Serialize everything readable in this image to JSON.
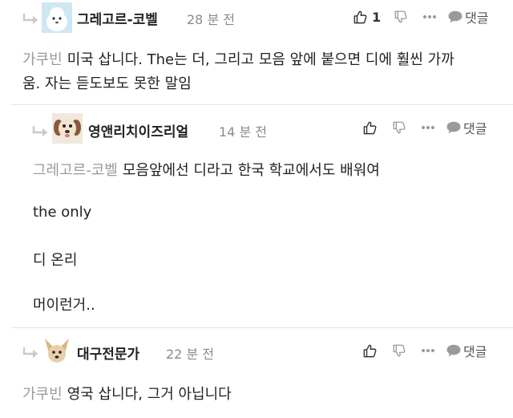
{
  "comments": [
    {
      "nickname": "그레고르-코벨",
      "time": "28 분 전",
      "like_count": "1",
      "reply_label": "댓글",
      "mention": "가쿠빈",
      "lines": [
        "미국 삽니다. The는 더, 그리고 모음 앞에 붙으면 디에 훨씬 가까",
        "움. 자는 듣도보도 못한 말임"
      ]
    },
    {
      "nickname": "영앤리치이즈리얼",
      "time": "14 분 전",
      "like_count": "",
      "reply_label": "댓글",
      "mention": "그레고르-코벨",
      "lines": [
        "모음앞에선 디라고 한국 학교에서도 배워여",
        "the only",
        "디 온리",
        "머이런거.."
      ]
    },
    {
      "nickname": "대구전문가",
      "time": "22 분 전",
      "like_count": "",
      "reply_label": "댓글",
      "mention": "가쿠빈",
      "lines": [
        "영국 삽니다, 그거 아닙니다"
      ]
    }
  ],
  "icons": {
    "reply_arrow": "reply-arrow-icon",
    "like": "thumbs-up-icon",
    "dislike": "thumbs-down-icon",
    "more": "more-dots-icon",
    "reply": "speech-bubble-icon"
  },
  "colors": {
    "mention": "#9a9a9a",
    "divider": "#e3e3e3",
    "icon_gray": "#9a9a9a"
  }
}
